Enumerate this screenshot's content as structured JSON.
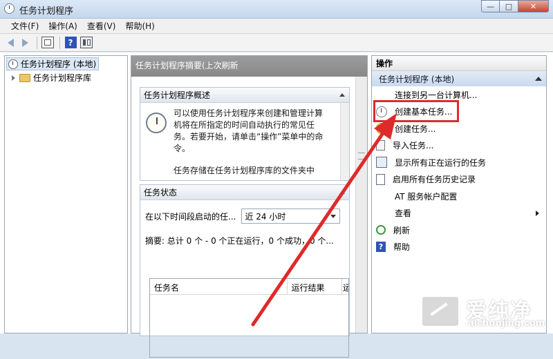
{
  "window": {
    "title": "任务计划程序"
  },
  "menu": {
    "items": [
      "文件(F)",
      "操作(A)",
      "查看(V)",
      "帮助(H)"
    ]
  },
  "toolbar": {
    "icons": [
      "back-arrow-icon",
      "forward-arrow-icon",
      "show-hide-tree-icon",
      "help-icon",
      "show-hide-action-pane-icon"
    ]
  },
  "tree": {
    "root": "任务计划程序 (本地)",
    "child": "任务计划程序库"
  },
  "middle": {
    "header": "任务计划程序摘要(上次刷新",
    "overview": {
      "title": "任务计划程序概述",
      "text": "可以使用任务计划程序来创建和管理计算机将在所指定的时间自动执行的常见任务。若要开始，请单击“操作”菜单中的命令。",
      "text2": "任务存储在任务计划程序库的文件夹中"
    },
    "status": {
      "title": "任务状态",
      "filter_label": "在以下时间段启动的任...",
      "filter_value": "近 24 小时",
      "summary": "摘要: 总计 0 个 - 0 个正在运行，0 个成功，0 个...",
      "columns": [
        "任务名",
        "运行结果",
        "运"
      ]
    }
  },
  "actions": {
    "header": "操作",
    "group": "任务计划程序 (本地)",
    "items": [
      {
        "label": "连接到另一台计算机...",
        "icon": "none"
      },
      {
        "label": "创建基本任务...",
        "icon": "create-basic-task-icon"
      },
      {
        "label": "创建任务...",
        "icon": "create-task-icon"
      },
      {
        "label": "导入任务...",
        "icon": "import-task-icon"
      },
      {
        "label": "显示所有正在运行的任务",
        "icon": "running-tasks-icon"
      },
      {
        "label": "启用所有任务历史记录",
        "icon": "history-icon"
      },
      {
        "label": "AT 服务帐户配置",
        "icon": "none"
      },
      {
        "label": "查看",
        "icon": "none"
      },
      {
        "label": "刷新",
        "icon": "refresh-icon"
      },
      {
        "label": "帮助",
        "icon": "help-icon"
      }
    ]
  },
  "watermark": {
    "cn": "爱纯净",
    "en": "aichunjing.com"
  },
  "colors": {
    "highlight": "#de2a2a",
    "action_group": "#c9d9ee"
  }
}
